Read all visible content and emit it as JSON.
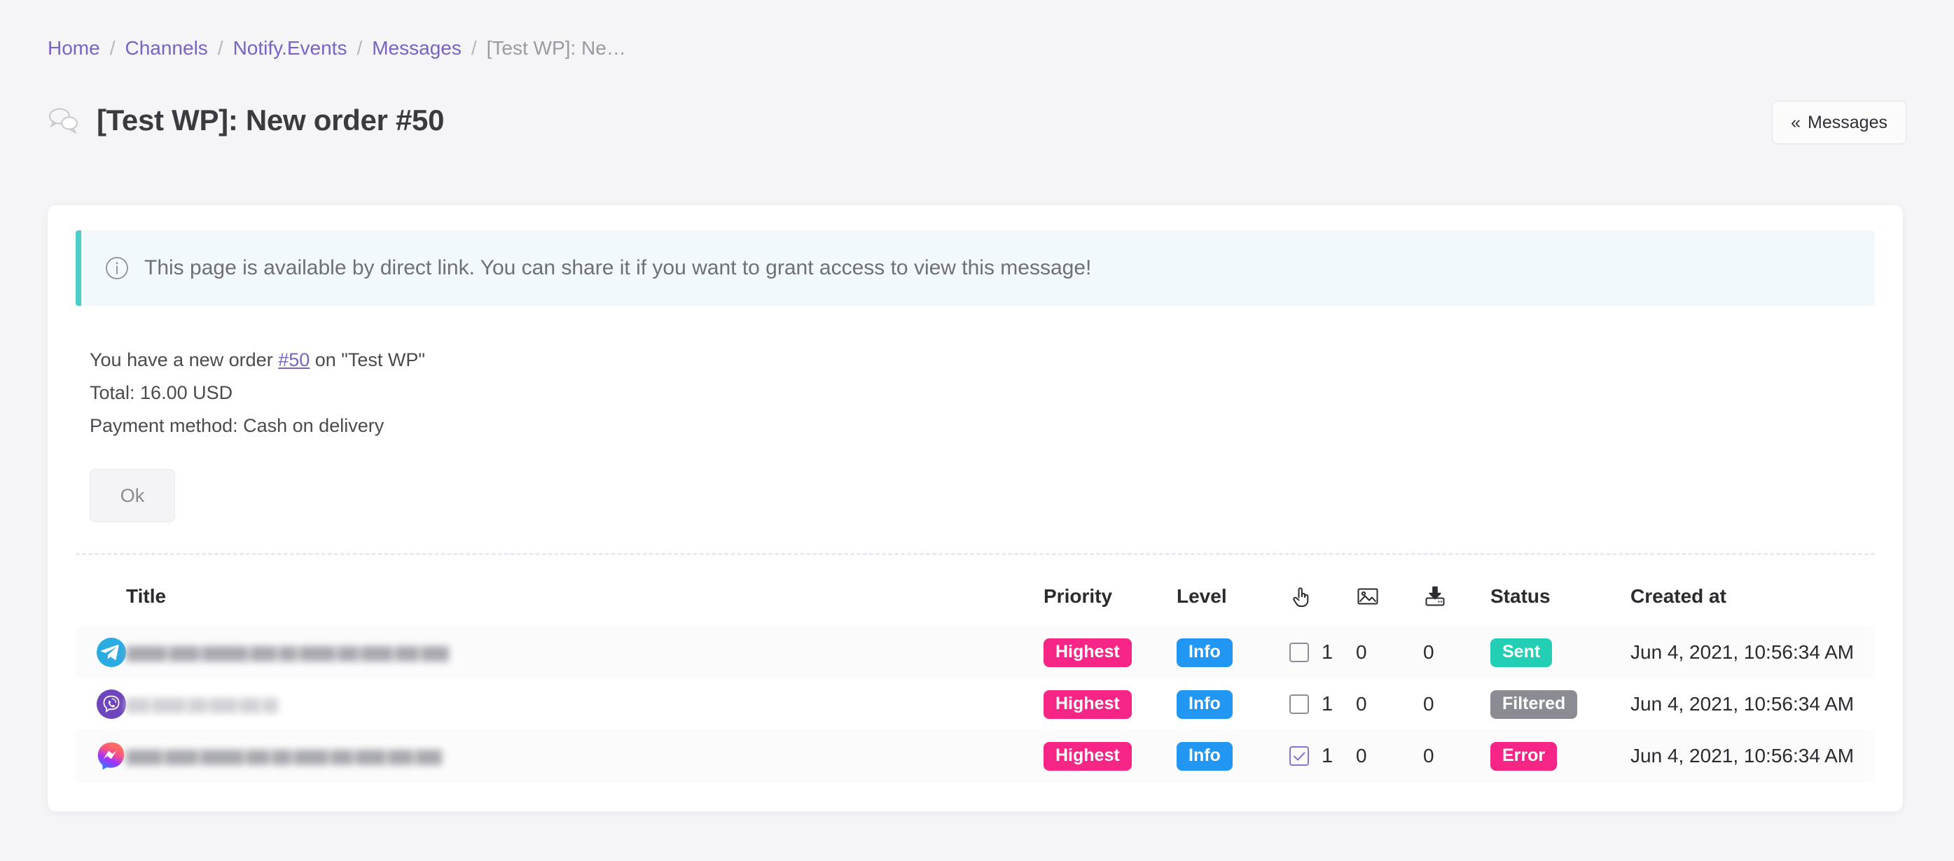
{
  "breadcrumb": {
    "separator": "/",
    "items": [
      {
        "label": "Home",
        "current": false
      },
      {
        "label": "Channels",
        "current": false
      },
      {
        "label": "Notify.Events",
        "current": false
      },
      {
        "label": "Messages",
        "current": false
      },
      {
        "label": "[Test WP]: Ne…",
        "current": true
      }
    ]
  },
  "header": {
    "title": "[Test WP]: New order #50",
    "icon": "chat-bubbles-icon",
    "back_button": {
      "label": "Messages",
      "chevron": "«"
    }
  },
  "alert": {
    "icon": "info-circle-icon",
    "text": "This page is available by direct link. You can share it if you want to grant access to view this message!",
    "accent_color": "#4ecdc4",
    "background_color": "#f2f9fc"
  },
  "message": {
    "line1_before": "You have a new order ",
    "line1_link": "#50",
    "line1_after": " on \"Test WP\"",
    "line2": "Total: 16.00 USD",
    "line3": "Payment method: Cash on delivery",
    "ok_button": "Ok"
  },
  "table": {
    "columns": [
      {
        "key": "channel",
        "label": "",
        "icon": ""
      },
      {
        "key": "title",
        "label": "Title",
        "icon": ""
      },
      {
        "key": "priority",
        "label": "Priority",
        "icon": ""
      },
      {
        "key": "level",
        "label": "Level",
        "icon": ""
      },
      {
        "key": "clicks",
        "label": "",
        "icon": "pointing-hand-icon"
      },
      {
        "key": "images",
        "label": "",
        "icon": "image-icon"
      },
      {
        "key": "downloads",
        "label": "",
        "icon": "download-tray-icon"
      },
      {
        "key": "status",
        "label": "Status",
        "icon": ""
      },
      {
        "key": "created_at",
        "label": "Created at",
        "icon": ""
      }
    ],
    "rows": [
      {
        "channel_icon": "telegram-icon",
        "title": "",
        "priority": "Highest",
        "level": "Info",
        "checked": false,
        "clicks": "1",
        "images": "0",
        "downloads": "0",
        "status": "Sent",
        "status_color": "#22ceb4",
        "created_at": "Jun 4, 2021, 10:56:34 AM"
      },
      {
        "channel_icon": "viber-icon",
        "title": "",
        "priority": "Highest",
        "level": "Info",
        "checked": false,
        "clicks": "1",
        "images": "0",
        "downloads": "0",
        "status": "Filtered",
        "status_color": "#8b8b94",
        "created_at": "Jun 4, 2021, 10:56:34 AM"
      },
      {
        "channel_icon": "messenger-icon",
        "title": "",
        "priority": "Highest",
        "level": "Info",
        "checked": true,
        "clicks": "1",
        "images": "0",
        "downloads": "0",
        "status": "Error",
        "status_color": "#f72585",
        "created_at": "Jun 4, 2021, 10:56:34 AM"
      }
    ]
  },
  "colors": {
    "page_background": "#f5f4f7",
    "link": "#7b63c4",
    "priority_badge": "#f72585",
    "level_badge": "#2196f3"
  }
}
